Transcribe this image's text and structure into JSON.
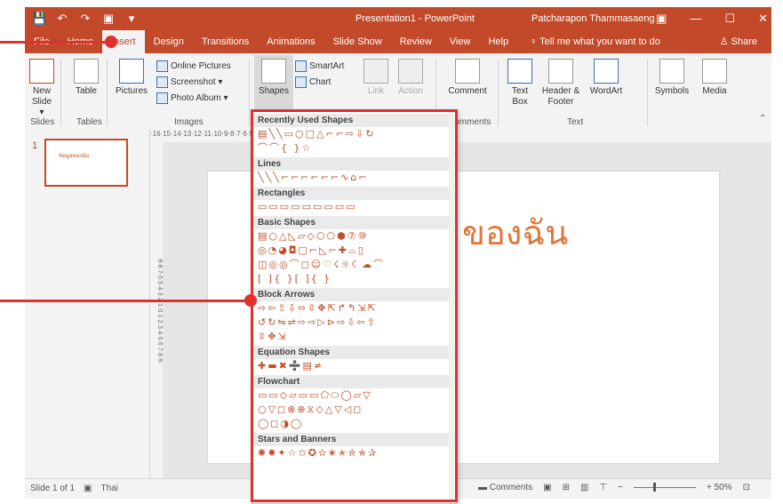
{
  "titlebar": {
    "quick_access": [
      "💾",
      "↶",
      "↷",
      "▣",
      "▾"
    ],
    "title": "Presentation1 - PowerPoint",
    "user": "Patcharapon Thammasaeng",
    "controls": [
      "▣",
      "—",
      "☐",
      "✕"
    ]
  },
  "tabs": [
    "File",
    "Home",
    "Insert",
    "Design",
    "Transitions",
    "Animations",
    "Slide Show",
    "Review",
    "View",
    "Help"
  ],
  "tell_me": "Tell me what you want to do",
  "share": "Share",
  "ribbon": {
    "new_slide": "New Slide ▾",
    "table": "Table",
    "pictures": "Pictures",
    "online_pictures": "Online Pictures",
    "screenshot": "Screenshot ▾",
    "photo_album": "Photo Album ▾",
    "shapes": "Shapes",
    "smartart": "SmartArt",
    "chart": "Chart",
    "link": "Link",
    "action": "Action",
    "comment": "Comment",
    "text_box": "Text Box",
    "header_footer": "Header & Footer",
    "wordart": "WordArt",
    "symbols": "Symbols",
    "media": "Media",
    "groups": {
      "slides": "Slides",
      "tables": "Tables",
      "images": "Images",
      "comments": "Comments",
      "text": "Text"
    }
  },
  "thumbnail": {
    "number": "1",
    "title": "ข้อมูลของฉัน"
  },
  "rulers": {
    "top": "·16·15·14·13·12·11·10·9·8·7·6·5·4·3·2·1·0·1·2·3·4·5·6·7·8·9·10·11·12·13·14·15·16·",
    "left": "·9·8·7·6·5·4·3·2·1·0·1·2·3·4·5·6·7·8·9·"
  },
  "slide_text": "ของฉัน",
  "shapes_menu": {
    "sections": [
      {
        "title": "Recently Used Shapes",
        "rows": [
          "▤╲╲▭○□△⌐⌐⇨⇩↻",
          "⌒⌒{ }☆"
        ]
      },
      {
        "title": "Lines",
        "rows": [
          "╲╲╲⌐⌐⌐⌐⌐⌐∿⌂⌐"
        ]
      },
      {
        "title": "Rectangles",
        "rows": [
          "▭▭▭▭▭▭▭▭▭"
        ]
      },
      {
        "title": "Basic Shapes",
        "rows": [
          "▤○△◺▱◇⬡⬠⬢⑦⑩",
          "◎◔◕◘▢⌐◺⌐✚⌓▯",
          "◫◎◎⌒◻☺♡☇☼☾☁⌒",
          "[ ]{ }[ ]{ }"
        ]
      },
      {
        "title": "Block Arrows",
        "rows": [
          "⇨⇦⇧⇩⬄⇳✥⇱↱↰⇲⇱",
          "↺↻⇋⇌⇨⇨▷⊳⇨⇩⇦⇧",
          "⇳✥⇲"
        ]
      },
      {
        "title": "Equation Shapes",
        "rows": [
          "✚▬✖➗▤≠"
        ]
      },
      {
        "title": "Flowchart",
        "rows": [
          "▭▭◇▱▭▭⬠⬭◯▱▽",
          "○▽◻⊗⊕⧖◇△▽◁◻",
          "◯◻◑◯"
        ]
      },
      {
        "title": "Stars and Banners",
        "rows": [
          "✺✹✦☆✩✪✫✬✭✮✯✰"
        ]
      }
    ]
  },
  "status": {
    "slide_info": "Slide 1 of 1",
    "language": "Thai",
    "comments": "Comments",
    "zoom": "+ 50%"
  },
  "colors": {
    "accent": "#c24a2a",
    "highlight": "#e0312e"
  }
}
